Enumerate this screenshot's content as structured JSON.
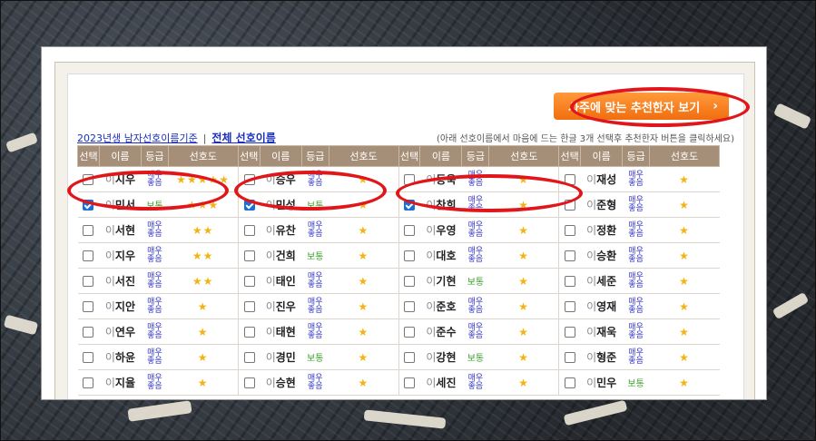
{
  "header": {
    "recommend_button": "사주에 맞는 추천한자 보기",
    "recommend_chevron": "›",
    "year_link": "2023년생 남자선호이름기준",
    "separator": "|",
    "all_link": "전체 선호이름",
    "hint": "(아래 선호이름에서 마음에 드는 한글 3개 선택후 추천한자 버튼을 클릭하세요)"
  },
  "columns": [
    "선택",
    "이름",
    "등급",
    "선호도"
  ],
  "grade_labels": {
    "excellent": "매우좋음",
    "normal": "보통"
  },
  "surname": "이",
  "table": {
    "groups": [
      [
        {
          "given": "시우",
          "checked": false,
          "grade": "excellent",
          "stars": 5
        },
        {
          "given": "민서",
          "checked": true,
          "grade": "normal",
          "stars": 3
        },
        {
          "given": "서현",
          "checked": false,
          "grade": "excellent",
          "stars": 2
        },
        {
          "given": "지우",
          "checked": false,
          "grade": "excellent",
          "stars": 2
        },
        {
          "given": "서진",
          "checked": false,
          "grade": "excellent",
          "stars": 2
        },
        {
          "given": "지안",
          "checked": false,
          "grade": "excellent",
          "stars": 1
        },
        {
          "given": "연우",
          "checked": false,
          "grade": "excellent",
          "stars": 1
        },
        {
          "given": "하윤",
          "checked": false,
          "grade": "excellent",
          "stars": 1
        },
        {
          "given": "지율",
          "checked": false,
          "grade": "excellent",
          "stars": 1
        }
      ],
      [
        {
          "given": "승우",
          "checked": false,
          "grade": "excellent",
          "stars": 1
        },
        {
          "given": "민성",
          "checked": true,
          "grade": "normal",
          "stars": 1
        },
        {
          "given": "유찬",
          "checked": false,
          "grade": "excellent",
          "stars": 1
        },
        {
          "given": "건희",
          "checked": false,
          "grade": "normal",
          "stars": 1
        },
        {
          "given": "태인",
          "checked": false,
          "grade": "excellent",
          "stars": 1
        },
        {
          "given": "진우",
          "checked": false,
          "grade": "excellent",
          "stars": 1
        },
        {
          "given": "태현",
          "checked": false,
          "grade": "excellent",
          "stars": 1
        },
        {
          "given": "경민",
          "checked": false,
          "grade": "normal",
          "stars": 1
        },
        {
          "given": "승현",
          "checked": false,
          "grade": "excellent",
          "stars": 1
        }
      ],
      [
        {
          "given": "동욱",
          "checked": false,
          "grade": "excellent",
          "stars": 1
        },
        {
          "given": "찬희",
          "checked": true,
          "grade": "excellent",
          "stars": 1
        },
        {
          "given": "우영",
          "checked": false,
          "grade": "excellent",
          "stars": 1
        },
        {
          "given": "대호",
          "checked": false,
          "grade": "excellent",
          "stars": 1
        },
        {
          "given": "기현",
          "checked": false,
          "grade": "normal",
          "stars": 1
        },
        {
          "given": "준호",
          "checked": false,
          "grade": "excellent",
          "stars": 1
        },
        {
          "given": "준수",
          "checked": false,
          "grade": "excellent",
          "stars": 1
        },
        {
          "given": "강현",
          "checked": false,
          "grade": "normal",
          "stars": 1
        },
        {
          "given": "세진",
          "checked": false,
          "grade": "excellent",
          "stars": 1
        }
      ],
      [
        {
          "given": "재성",
          "checked": false,
          "grade": "excellent",
          "stars": 1
        },
        {
          "given": "준형",
          "checked": false,
          "grade": "excellent",
          "stars": 1
        },
        {
          "given": "정환",
          "checked": false,
          "grade": "excellent",
          "stars": 1
        },
        {
          "given": "승환",
          "checked": false,
          "grade": "excellent",
          "stars": 1
        },
        {
          "given": "세준",
          "checked": false,
          "grade": "excellent",
          "stars": 1
        },
        {
          "given": "영재",
          "checked": false,
          "grade": "excellent",
          "stars": 1
        },
        {
          "given": "재욱",
          "checked": false,
          "grade": "excellent",
          "stars": 1
        },
        {
          "given": "형준",
          "checked": false,
          "grade": "excellent",
          "stars": 1
        },
        {
          "given": "민우",
          "checked": false,
          "grade": "normal",
          "stars": 1
        }
      ]
    ]
  },
  "colors": {
    "highlight_ring": "#e0161b",
    "button_orange": "#f27d1a",
    "header_brown": "#a68f78",
    "grade_excellent": "#3436c9",
    "grade_normal": "#3ea02b",
    "star": "#f2b414"
  }
}
